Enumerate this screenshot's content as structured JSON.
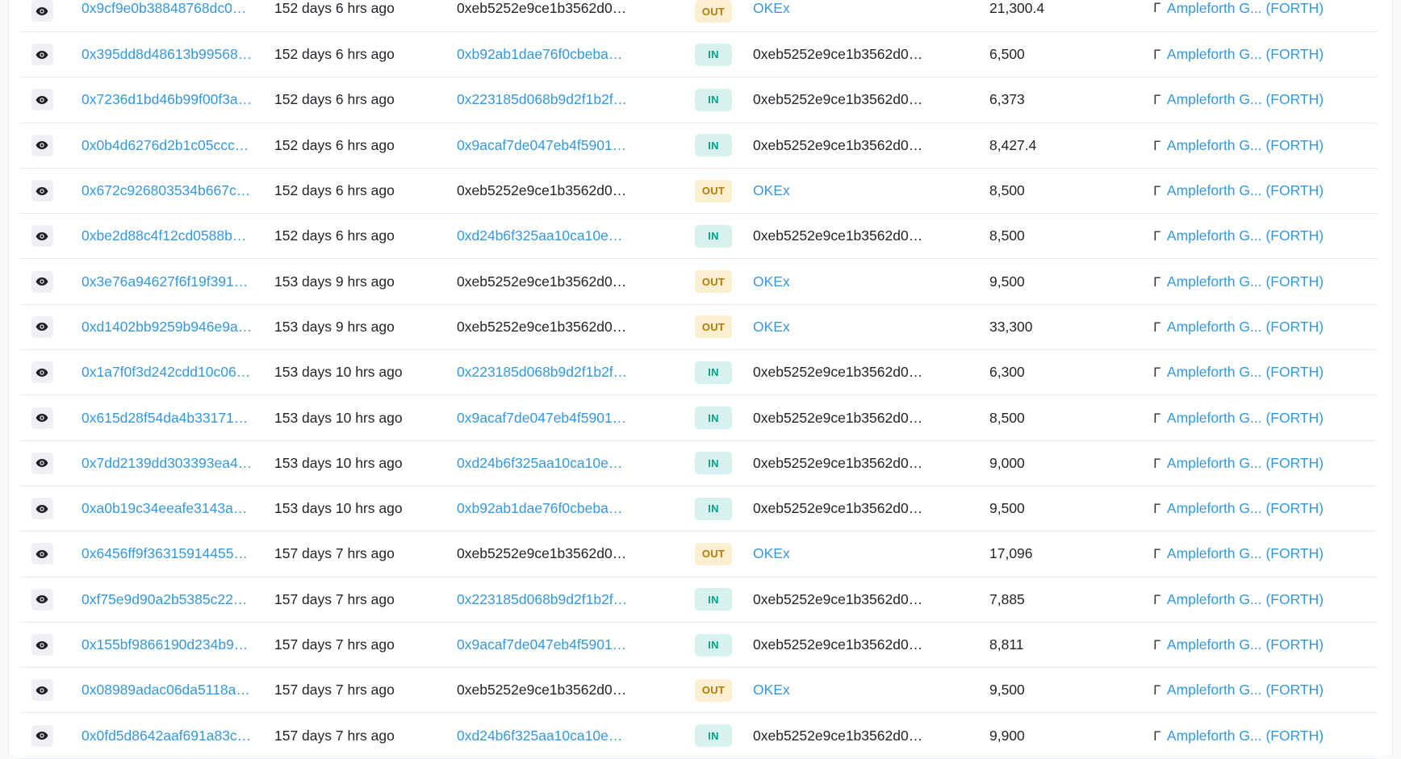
{
  "colors": {
    "link": "#3498db",
    "in_badge_bg": "#d7f2ee",
    "in_badge_text": "#00a186",
    "out_badge_bg": "#fbeed1",
    "out_badge_text": "#b47d00"
  },
  "icons": {
    "view": "eye-icon",
    "token": "token-icon"
  },
  "rows": [
    {
      "hash": "0x9cf9e0b38848768dc0…",
      "age": "152 days 6 hrs ago",
      "from": "0xeb5252e9ce1b3562d0…",
      "from_link": false,
      "direction": "OUT",
      "to": "OKEx",
      "to_link": true,
      "quantity": "21,300.4",
      "token_name": "Ampleforth G...",
      "token_symbol": "(FORTH)"
    },
    {
      "hash": "0x395dd8d48613b99568…",
      "age": "152 days 6 hrs ago",
      "from": "0xb92ab1dae76f0cbeba…",
      "from_link": true,
      "direction": "IN",
      "to": "0xeb5252e9ce1b3562d0…",
      "to_link": false,
      "quantity": "6,500",
      "token_name": "Ampleforth G...",
      "token_symbol": "(FORTH)"
    },
    {
      "hash": "0x7236d1bd46b99f00f3a…",
      "age": "152 days 6 hrs ago",
      "from": "0x223185d068b9d2f1b2f…",
      "from_link": true,
      "direction": "IN",
      "to": "0xeb5252e9ce1b3562d0…",
      "to_link": false,
      "quantity": "6,373",
      "token_name": "Ampleforth G...",
      "token_symbol": "(FORTH)"
    },
    {
      "hash": "0x0b4d6276d2b1c05ccc…",
      "age": "152 days 6 hrs ago",
      "from": "0x9acaf7de047eb4f5901…",
      "from_link": true,
      "direction": "IN",
      "to": "0xeb5252e9ce1b3562d0…",
      "to_link": false,
      "quantity": "8,427.4",
      "token_name": "Ampleforth G...",
      "token_symbol": "(FORTH)"
    },
    {
      "hash": "0x672c926803534b667c…",
      "age": "152 days 6 hrs ago",
      "from": "0xeb5252e9ce1b3562d0…",
      "from_link": false,
      "direction": "OUT",
      "to": "OKEx",
      "to_link": true,
      "quantity": "8,500",
      "token_name": "Ampleforth G...",
      "token_symbol": "(FORTH)"
    },
    {
      "hash": "0xbe2d88c4f12cd0588b…",
      "age": "152 days 6 hrs ago",
      "from": "0xd24b6f325aa10ca10e…",
      "from_link": true,
      "direction": "IN",
      "to": "0xeb5252e9ce1b3562d0…",
      "to_link": false,
      "quantity": "8,500",
      "token_name": "Ampleforth G...",
      "token_symbol": "(FORTH)"
    },
    {
      "hash": "0x3e76a94627f6f19f391…",
      "age": "153 days 9 hrs ago",
      "from": "0xeb5252e9ce1b3562d0…",
      "from_link": false,
      "direction": "OUT",
      "to": "OKEx",
      "to_link": true,
      "quantity": "9,500",
      "token_name": "Ampleforth G...",
      "token_symbol": "(FORTH)"
    },
    {
      "hash": "0xd1402bb9259b946e9a…",
      "age": "153 days 9 hrs ago",
      "from": "0xeb5252e9ce1b3562d0…",
      "from_link": false,
      "direction": "OUT",
      "to": "OKEx",
      "to_link": true,
      "quantity": "33,300",
      "token_name": "Ampleforth G...",
      "token_symbol": "(FORTH)"
    },
    {
      "hash": "0x1a7f0f3d242cdd10c06…",
      "age": "153 days 10 hrs ago",
      "from": "0x223185d068b9d2f1b2f…",
      "from_link": true,
      "direction": "IN",
      "to": "0xeb5252e9ce1b3562d0…",
      "to_link": false,
      "quantity": "6,300",
      "token_name": "Ampleforth G...",
      "token_symbol": "(FORTH)"
    },
    {
      "hash": "0x615d28f54da4b33171…",
      "age": "153 days 10 hrs ago",
      "from": "0x9acaf7de047eb4f5901…",
      "from_link": true,
      "direction": "IN",
      "to": "0xeb5252e9ce1b3562d0…",
      "to_link": false,
      "quantity": "8,500",
      "token_name": "Ampleforth G...",
      "token_symbol": "(FORTH)"
    },
    {
      "hash": "0x7dd2139dd303393ea4…",
      "age": "153 days 10 hrs ago",
      "from": "0xd24b6f325aa10ca10e…",
      "from_link": true,
      "direction": "IN",
      "to": "0xeb5252e9ce1b3562d0…",
      "to_link": false,
      "quantity": "9,000",
      "token_name": "Ampleforth G...",
      "token_symbol": "(FORTH)"
    },
    {
      "hash": "0xa0b19c34eeafe3143a…",
      "age": "153 days 10 hrs ago",
      "from": "0xb92ab1dae76f0cbeba…",
      "from_link": true,
      "direction": "IN",
      "to": "0xeb5252e9ce1b3562d0…",
      "to_link": false,
      "quantity": "9,500",
      "token_name": "Ampleforth G...",
      "token_symbol": "(FORTH)"
    },
    {
      "hash": "0x6456ff9f36315914455…",
      "age": "157 days 7 hrs ago",
      "from": "0xeb5252e9ce1b3562d0…",
      "from_link": false,
      "direction": "OUT",
      "to": "OKEx",
      "to_link": true,
      "quantity": "17,096",
      "token_name": "Ampleforth G...",
      "token_symbol": "(FORTH)"
    },
    {
      "hash": "0xf75e9d90a2b5385c22…",
      "age": "157 days 7 hrs ago",
      "from": "0x223185d068b9d2f1b2f…",
      "from_link": true,
      "direction": "IN",
      "to": "0xeb5252e9ce1b3562d0…",
      "to_link": false,
      "quantity": "7,885",
      "token_name": "Ampleforth G...",
      "token_symbol": "(FORTH)"
    },
    {
      "hash": "0x155bf9866190d234b9…",
      "age": "157 days 7 hrs ago",
      "from": "0x9acaf7de047eb4f5901…",
      "from_link": true,
      "direction": "IN",
      "to": "0xeb5252e9ce1b3562d0…",
      "to_link": false,
      "quantity": "8,811",
      "token_name": "Ampleforth G...",
      "token_symbol": "(FORTH)"
    },
    {
      "hash": "0x08989adac06da5118a…",
      "age": "157 days 7 hrs ago",
      "from": "0xeb5252e9ce1b3562d0…",
      "from_link": false,
      "direction": "OUT",
      "to": "OKEx",
      "to_link": true,
      "quantity": "9,500",
      "token_name": "Ampleforth G...",
      "token_symbol": "(FORTH)"
    },
    {
      "hash": "0x0fd5d8642aaf691a83c…",
      "age": "157 days 7 hrs ago",
      "from": "0xd24b6f325aa10ca10e…",
      "from_link": true,
      "direction": "IN",
      "to": "0xeb5252e9ce1b3562d0…",
      "to_link": false,
      "quantity": "9,900",
      "token_name": "Ampleforth G...",
      "token_symbol": "(FORTH)"
    }
  ]
}
